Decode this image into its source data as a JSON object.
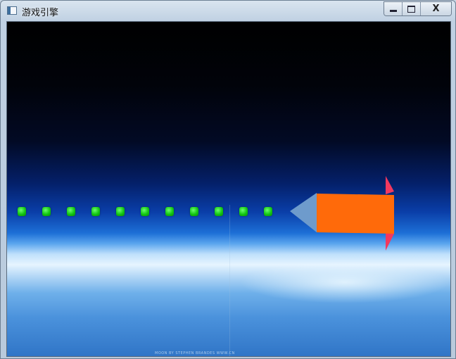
{
  "window": {
    "title": "游戏引擎",
    "controls": {
      "minimize": "▁",
      "maximize": "□",
      "close": "X"
    }
  },
  "scene": {
    "pellet_count": 11,
    "pellet_color": "#12c612",
    "ship": {
      "body_color": "#ff6a0a",
      "nose_color": "#6e9bcc",
      "fin_color": "#f2385e"
    },
    "credit_text": "MOON BY STEPHEN BRANDES   WWW.CN"
  }
}
